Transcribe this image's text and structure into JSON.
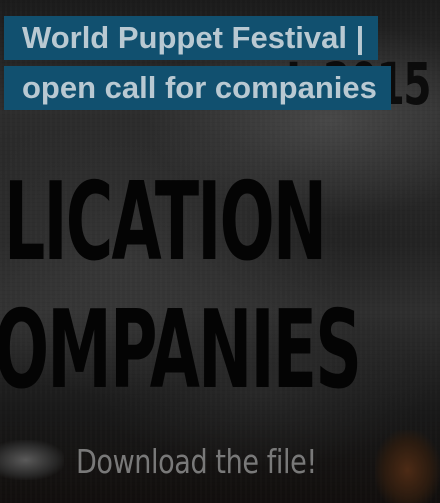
{
  "card": {
    "title": "World Puppet Festival | open call for companies"
  },
  "poster": {
    "year_text": "L 2015",
    "line1": "LICATION",
    "line2": "OMPANIES",
    "cta": "Download the file!"
  },
  "colors": {
    "title_bg": "#11506f",
    "title_text": "#b9c9d2"
  }
}
